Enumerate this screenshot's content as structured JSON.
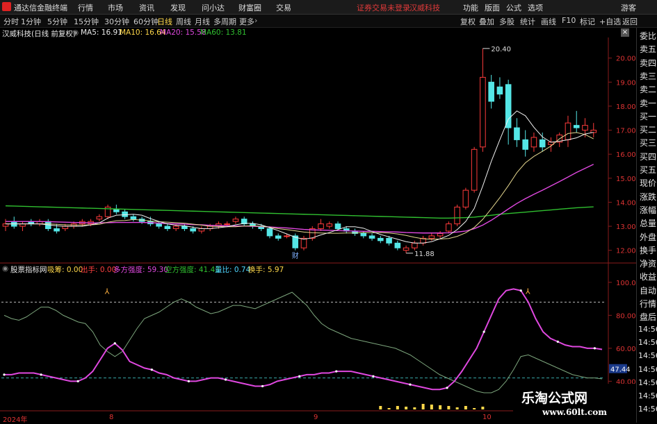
{
  "app": {
    "title": "通达信金融终端",
    "menu": [
      "行情",
      "市场",
      "资讯",
      "发现",
      "问小达",
      "财富圈",
      "交易"
    ],
    "warning": "证券交易未登录",
    "stock_name_top": "汉威科技",
    "right_menu": [
      "功能",
      "版面",
      "公式",
      "选项"
    ],
    "user": "游客"
  },
  "toolbar": {
    "timeframes": [
      "分时",
      "1分钟",
      "5分钟",
      "15分钟",
      "30分钟",
      "60分钟",
      "日线",
      "周线",
      "月线",
      "多周期",
      "更多"
    ],
    "active": "日线",
    "tools": [
      "复权",
      "叠加",
      "多股",
      "统计",
      "画线",
      "F10",
      "标记",
      "+自选",
      "返回"
    ]
  },
  "main": {
    "stock": "汉威科技(日线 前复权)",
    "ma": [
      {
        "label": "MA5: 16.91",
        "color": "#e8e8e8"
      },
      {
        "label": "MA10: 16.64",
        "color": "#ffd84a"
      },
      {
        "label": "MA20: 15.58",
        "color": "#e048e0"
      },
      {
        "label": "MA60: 13.81",
        "color": "#30c030"
      }
    ],
    "high_marker": "20.40",
    "low_marker": "11.88",
    "event_marker": "财",
    "y_ticks": [
      "20.00",
      "19.00",
      "18.00",
      "17.00",
      "16.00",
      "15.00",
      "14.00",
      "13.00",
      "12.00"
    ]
  },
  "indicator": {
    "name": "股票指标网",
    "fields": [
      {
        "label": "吸筹: 0.00",
        "color": "#ffd84a"
      },
      {
        "label": "出手: 0.00",
        "color": "#ff4040"
      },
      {
        "label": "多方强度: 59.30",
        "color": "#e048e0"
      },
      {
        "label": "空方强度: 41.43",
        "color": "#30c030"
      },
      {
        "label": "量比: 0.74",
        "color": "#4fd6ff"
      },
      {
        "label": "换手: 5.97",
        "color": "#ffd84a"
      }
    ],
    "y_ticks": [
      "100.0",
      "80.00",
      "60.00",
      "40.00"
    ],
    "current_badge": "47.44"
  },
  "bottom_axis": [
    "2024年",
    "8",
    "9",
    "10"
  ],
  "sidebar": [
    "委比",
    "卖五",
    "卖四",
    "卖三",
    "卖二",
    "卖一",
    "买一",
    "买二",
    "买三",
    "买四",
    "买五",
    "现价",
    "涨跌",
    "涨幅",
    "总量",
    "外盘",
    "换手",
    "净资",
    "收益",
    "自动",
    "行情",
    "盘后",
    "14:56",
    "14:56",
    "14:56",
    "14:56",
    "14:56",
    "14:56",
    "14:56"
  ],
  "watermark": {
    "title": "乐淘公式网",
    "url": "www.60lt.com"
  },
  "chart_data": {
    "type": "line",
    "note_price_range": [
      11.5,
      20.8
    ],
    "candles": [
      [
        13.0,
        13.3,
        12.8,
        13.1
      ],
      [
        13.2,
        13.4,
        12.9,
        13.0
      ],
      [
        13.0,
        13.2,
        12.8,
        13.1
      ],
      [
        13.2,
        13.3,
        13.0,
        13.1
      ],
      [
        13.1,
        13.3,
        13.0,
        13.2
      ],
      [
        13.2,
        13.3,
        12.8,
        12.9
      ],
      [
        12.9,
        13.1,
        12.7,
        12.8
      ],
      [
        12.9,
        13.1,
        12.8,
        13.0
      ],
      [
        13.0,
        13.2,
        12.9,
        13.1
      ],
      [
        13.1,
        13.3,
        13.0,
        13.2
      ],
      [
        13.1,
        13.3,
        13.0,
        13.2
      ],
      [
        13.3,
        13.5,
        13.2,
        13.4
      ],
      [
        13.4,
        13.9,
        13.3,
        13.8
      ],
      [
        13.7,
        13.9,
        13.5,
        13.6
      ],
      [
        13.6,
        13.7,
        13.3,
        13.4
      ],
      [
        13.4,
        13.5,
        13.2,
        13.3
      ],
      [
        13.3,
        13.4,
        13.1,
        13.2
      ],
      [
        13.2,
        13.4,
        13.0,
        13.1
      ],
      [
        13.1,
        13.2,
        12.9,
        13.0
      ],
      [
        13.0,
        13.1,
        12.8,
        12.9
      ],
      [
        12.9,
        13.1,
        12.8,
        13.0
      ],
      [
        13.0,
        13.1,
        12.8,
        12.9
      ],
      [
        12.9,
        13.0,
        12.7,
        12.8
      ],
      [
        12.8,
        13.0,
        12.7,
        12.9
      ],
      [
        12.9,
        13.1,
        12.8,
        13.0
      ],
      [
        13.0,
        13.2,
        12.9,
        13.1
      ],
      [
        13.1,
        13.2,
        13.0,
        13.1
      ],
      [
        13.2,
        13.4,
        13.1,
        13.3
      ],
      [
        13.3,
        13.4,
        13.0,
        13.1
      ],
      [
        13.1,
        13.2,
        12.9,
        13.0
      ],
      [
        13.0,
        13.1,
        12.8,
        12.9
      ],
      [
        12.9,
        13.0,
        12.5,
        12.6
      ],
      [
        12.6,
        12.7,
        12.4,
        12.5
      ],
      [
        12.6,
        12.7,
        12.5,
        12.6
      ],
      [
        12.6,
        12.7,
        12.0,
        12.1
      ],
      [
        12.1,
        12.6,
        12.0,
        12.5
      ],
      [
        12.5,
        13.0,
        12.4,
        12.9
      ],
      [
        12.9,
        13.3,
        12.8,
        13.1
      ],
      [
        13.0,
        13.2,
        12.9,
        13.1
      ],
      [
        13.1,
        13.2,
        12.8,
        12.9
      ],
      [
        12.9,
        13.0,
        12.7,
        12.8
      ],
      [
        12.8,
        12.9,
        12.6,
        12.7
      ],
      [
        12.7,
        12.8,
        12.5,
        12.6
      ],
      [
        12.6,
        12.7,
        12.4,
        12.5
      ],
      [
        12.5,
        12.6,
        12.3,
        12.4
      ],
      [
        12.5,
        12.6,
        12.2,
        12.3
      ],
      [
        12.3,
        12.4,
        12.0,
        12.1
      ],
      [
        12.0,
        12.2,
        11.88,
        12.1
      ],
      [
        12.1,
        12.4,
        12.0,
        12.3
      ],
      [
        12.3,
        12.6,
        12.2,
        12.5
      ],
      [
        12.5,
        12.7,
        12.4,
        12.6
      ],
      [
        12.6,
        12.8,
        12.5,
        12.7
      ],
      [
        12.8,
        13.2,
        12.7,
        13.1
      ],
      [
        13.1,
        13.9,
        13.0,
        13.8
      ],
      [
        13.8,
        14.6,
        13.7,
        14.5
      ],
      [
        14.5,
        16.3,
        14.4,
        16.2
      ],
      [
        16.3,
        20.4,
        16.1,
        19.2
      ],
      [
        19.0,
        19.3,
        17.9,
        18.2
      ],
      [
        18.8,
        19.2,
        18.3,
        18.5
      ],
      [
        18.9,
        19.1,
        16.4,
        17.1
      ],
      [
        17.1,
        17.5,
        16.3,
        16.6
      ],
      [
        16.6,
        17.0,
        15.9,
        16.2
      ],
      [
        16.3,
        16.9,
        16.1,
        16.7
      ],
      [
        16.6,
        16.9,
        16.1,
        16.3
      ],
      [
        16.4,
        16.7,
        16.1,
        16.5
      ],
      [
        16.5,
        16.9,
        16.3,
        16.8
      ],
      [
        16.6,
        17.6,
        16.3,
        17.3
      ],
      [
        17.2,
        17.8,
        16.9,
        17.1
      ],
      [
        17.0,
        17.5,
        16.7,
        17.2
      ],
      [
        16.9,
        17.3,
        16.7,
        17.0
      ]
    ],
    "ma5": [
      13.1,
      13.1,
      13.1,
      13.1,
      13.1,
      13.06,
      13.02,
      13.0,
      13.0,
      13.0,
      13.06,
      13.14,
      13.34,
      13.46,
      13.48,
      13.5,
      13.46,
      13.32,
      13.2,
      13.1,
      13.04,
      13.02,
      12.96,
      12.9,
      12.9,
      12.94,
      12.98,
      13.06,
      13.12,
      13.12,
      13.06,
      12.94,
      12.82,
      12.68,
      12.54,
      12.46,
      12.52,
      12.64,
      12.74,
      12.86,
      12.98,
      12.98,
      12.92,
      12.78,
      12.66,
      12.56,
      12.46,
      12.36,
      12.3,
      12.3,
      12.36,
      12.48,
      12.62,
      12.86,
      13.2,
      13.74,
      14.68,
      15.7,
      16.6,
      17.46,
      17.8,
      17.6,
      17.12,
      16.72,
      16.5,
      16.54,
      16.6,
      16.68,
      16.84,
      16.91
    ],
    "ma10": [
      13.1,
      13.1,
      13.1,
      13.1,
      13.1,
      13.1,
      13.08,
      13.06,
      13.05,
      13.05,
      13.06,
      13.08,
      13.17,
      13.23,
      13.24,
      13.28,
      13.26,
      13.22,
      13.19,
      13.17,
      13.15,
      13.13,
      13.09,
      13.05,
      13.0,
      12.99,
      12.98,
      12.98,
      13.01,
      13.02,
      13.0,
      12.96,
      12.9,
      12.86,
      12.81,
      12.76,
      12.73,
      12.72,
      12.71,
      12.71,
      12.72,
      12.72,
      12.74,
      12.73,
      12.74,
      12.72,
      12.68,
      12.62,
      12.54,
      12.48,
      12.46,
      12.47,
      12.49,
      12.58,
      12.73,
      12.95,
      13.29,
      13.73,
      14.19,
      14.69,
      15.23,
      15.64,
      15.91,
      16.12,
      16.34,
      16.64,
      16.86,
      16.9,
      16.82,
      16.64
    ],
    "ma20": [
      13.2,
      13.2,
      13.2,
      13.2,
      13.2,
      13.19,
      13.18,
      13.17,
      13.16,
      13.15,
      13.14,
      13.14,
      13.15,
      13.16,
      13.16,
      13.16,
      13.16,
      13.15,
      13.13,
      13.11,
      13.1,
      13.09,
      13.07,
      13.06,
      13.04,
      13.03,
      13.02,
      13.01,
      13.01,
      13.0,
      12.99,
      12.97,
      12.95,
      12.93,
      12.9,
      12.87,
      12.85,
      12.84,
      12.83,
      12.82,
      12.81,
      12.8,
      12.79,
      12.79,
      12.78,
      12.77,
      12.76,
      12.74,
      12.73,
      12.72,
      12.72,
      12.72,
      12.73,
      12.76,
      12.8,
      12.9,
      13.05,
      13.25,
      13.48,
      13.72,
      13.95,
      14.15,
      14.33,
      14.5,
      14.68,
      14.86,
      15.05,
      15.24,
      15.41,
      15.58
    ],
    "ma60": [
      13.85,
      13.84,
      13.83,
      13.82,
      13.81,
      13.8,
      13.79,
      13.78,
      13.77,
      13.76,
      13.75,
      13.74,
      13.73,
      13.72,
      13.71,
      13.7,
      13.69,
      13.68,
      13.67,
      13.66,
      13.65,
      13.64,
      13.63,
      13.62,
      13.61,
      13.6,
      13.59,
      13.58,
      13.57,
      13.56,
      13.55,
      13.54,
      13.53,
      13.52,
      13.51,
      13.5,
      13.49,
      13.48,
      13.47,
      13.46,
      13.45,
      13.44,
      13.43,
      13.42,
      13.41,
      13.4,
      13.39,
      13.38,
      13.37,
      13.36,
      13.35,
      13.34,
      13.34,
      13.35,
      13.36,
      13.38,
      13.42,
      13.46,
      13.5,
      13.53,
      13.56,
      13.59,
      13.62,
      13.65,
      13.68,
      13.71,
      13.74,
      13.77,
      13.79,
      13.81
    ],
    "long_strength": [
      44,
      44,
      45,
      45,
      45,
      44,
      43,
      42,
      41,
      40,
      40,
      42,
      46,
      53,
      60,
      63,
      59,
      52,
      50,
      48,
      47,
      45,
      44,
      42,
      41,
      40,
      40,
      41,
      42,
      42,
      41,
      40,
      39,
      38,
      37,
      37,
      38,
      40,
      41,
      42,
      43,
      44,
      44,
      45,
      45,
      46,
      46,
      46,
      45,
      44,
      43,
      42,
      41,
      40,
      39,
      38,
      37,
      36,
      35,
      35,
      36,
      40,
      46,
      53,
      60,
      70,
      80,
      90,
      95,
      96,
      95,
      88,
      78,
      70,
      66,
      64,
      62,
      61,
      61,
      60,
      60,
      59.3
    ],
    "short_strength": [
      80,
      78,
      77,
      79,
      82,
      85,
      85,
      83,
      80,
      78,
      76,
      75,
      70,
      62,
      58,
      55,
      58,
      65,
      72,
      78,
      80,
      82,
      85,
      88,
      90,
      88,
      85,
      83,
      81,
      82,
      84,
      86,
      86,
      85,
      84,
      86,
      88,
      90,
      92,
      94,
      90,
      86,
      80,
      75,
      72,
      70,
      68,
      66,
      65,
      64,
      63,
      62,
      61,
      60,
      58,
      56,
      53,
      50,
      47,
      44,
      42,
      40,
      38,
      36,
      34,
      33,
      33,
      35,
      40,
      47,
      55,
      56,
      54,
      52,
      50,
      48,
      46,
      44,
      43,
      42,
      42,
      41.43
    ],
    "ylim_price": [
      11.5,
      20.8
    ],
    "ylim_ind": [
      25,
      105
    ]
  }
}
